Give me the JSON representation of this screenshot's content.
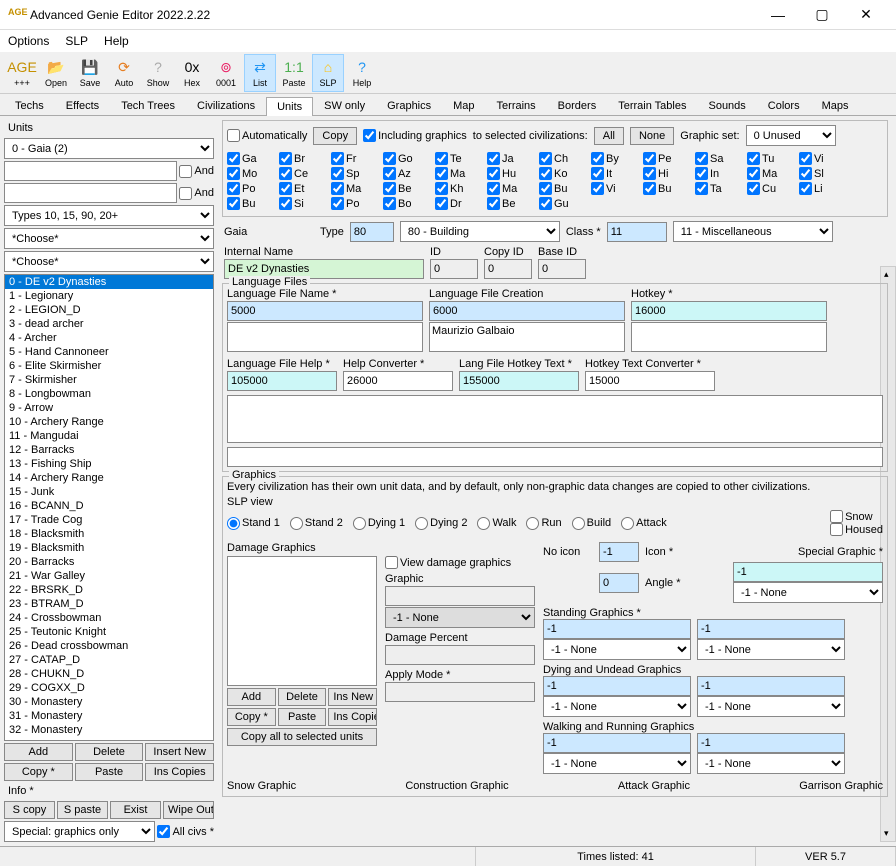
{
  "window": {
    "title": "Advanced Genie Editor 2022.2.22",
    "icon_label": "AGE"
  },
  "menu": [
    "Options",
    "SLP",
    "Help"
  ],
  "toolbar": [
    {
      "label": "+++",
      "name": "age-icon",
      "glyph": "AGE",
      "active": false,
      "color": "#c49000"
    },
    {
      "label": "Open",
      "name": "open-button",
      "glyph": "📂",
      "active": false
    },
    {
      "label": "Save",
      "name": "save-button",
      "glyph": "💾",
      "active": false
    },
    {
      "label": "Auto",
      "name": "auto-button",
      "glyph": "⟳",
      "active": false,
      "color": "#e67e22"
    },
    {
      "label": "Show",
      "name": "show-button",
      "glyph": "?",
      "active": false,
      "color": "#aaa"
    },
    {
      "label": "Hex",
      "name": "hex-button",
      "glyph": "0x",
      "active": false
    },
    {
      "label": "0001",
      "name": "0001-button",
      "glyph": "⊚",
      "active": false,
      "color": "#e91e63"
    },
    {
      "label": "List",
      "name": "list-button",
      "glyph": "⇄",
      "active": true,
      "color": "#2196f3"
    },
    {
      "label": "Paste",
      "name": "paste-button",
      "glyph": "1:1",
      "active": false,
      "color": "#4caf50"
    },
    {
      "label": "SLP",
      "name": "slp-button",
      "glyph": "⌂",
      "active": true,
      "color": "#ffc107"
    },
    {
      "label": "Help",
      "name": "help-button",
      "glyph": "?",
      "active": false,
      "color": "#2196f3"
    }
  ],
  "tabs": [
    "Techs",
    "Effects",
    "Tech Trees",
    "Civilizations",
    "Units",
    "SW only",
    "Graphics",
    "Map",
    "Terrains",
    "Borders",
    "Terrain Tables",
    "Sounds",
    "Colors",
    "Maps"
  ],
  "active_tab": "Units",
  "left": {
    "units_label": "Units",
    "civ_select": "0 - Gaia (2)",
    "and_label": "And",
    "types_filter": "Types 10, 15, 90, 20+",
    "choose": "*Choose*",
    "units": [
      "0 - DE v2 Dynasties",
      "1 - Legionary",
      "2 - LEGION_D",
      "3 - dead archer",
      "4 - Archer",
      "5 - Hand Cannoneer",
      "6 - Elite Skirmisher",
      "7 - Skirmisher",
      "8 - Longbowman",
      "9 - Arrow",
      "10 - Archery Range",
      "11 - Mangudai",
      "12 - Barracks",
      "13 - Fishing Ship",
      "14 - Archery Range",
      "15 - Junk",
      "16 - BCANN_D",
      "17 - Trade Cog",
      "18 - Blacksmith",
      "19 - Blacksmith",
      "20 - Barracks",
      "21 - War Galley",
      "22 - BRSRK_D",
      "23 - BTRAM_D",
      "24 - Crossbowman",
      "25 - Teutonic Knight",
      "26 - Dead crossbowman",
      "27 - CATAP_D",
      "28 - CHUKN_D",
      "29 - COGXX_D",
      "30 - Monastery",
      "31 - Monastery",
      "32 - Monastery"
    ],
    "selected_unit": 0,
    "buttons": {
      "add": "Add",
      "delete": "Delete",
      "insert_new": "Insert New",
      "copy": "Copy *",
      "paste": "Paste",
      "ins_copies": "Ins Copies",
      "info": "Info *",
      "s_copy": "S copy",
      "s_paste": "S paste",
      "exist": "Exist",
      "wipe_out": "Wipe Out",
      "special": "Special: graphics only",
      "all_civs": "All civs *"
    }
  },
  "right": {
    "auto_label": "Automatically",
    "copy_btn": "Copy",
    "including_label": "Including graphics",
    "to_selected_label": "to selected civilizations:",
    "all_btn": "All",
    "none_btn": "None",
    "graphic_set_label": "Graphic set:",
    "graphic_set_value": "0 Unused",
    "civs": [
      "Ga",
      "Br",
      "Fr",
      "Go",
      "Te",
      "Ja",
      "Ch",
      "By",
      "Pe",
      "Sa",
      "Tu",
      "Vi",
      "Mo",
      "Ce",
      "Sp",
      "Az",
      "Ma",
      "Hu",
      "Ko",
      "It",
      "Hi",
      "In",
      "Ma",
      "Sl",
      "Po",
      "Et",
      "Ma",
      "Be",
      "Kh",
      "Ma",
      "Bu",
      "Vi",
      "Bu",
      "Ta",
      "Cu",
      "Li",
      "Bu",
      "Si",
      "Po",
      "Bo",
      "Dr",
      "Be",
      "Gu"
    ],
    "unit_header": {
      "civ_name": "Gaia",
      "type_label": "Type",
      "type_value": "80",
      "type_combo": "80 - Building",
      "class_label": "Class *",
      "class_value": "11",
      "class_combo": "11 - Miscellaneous",
      "internal_name_label": "Internal Name",
      "internal_name": "DE v2 Dynasties",
      "id_label": "ID",
      "id_value": "0",
      "copy_id_label": "Copy ID",
      "copy_id_value": "0",
      "base_id_label": "Base ID",
      "base_id_value": "0"
    },
    "lang": {
      "group": "Language Files",
      "name_label": "Language File Name *",
      "name_value": "5000",
      "creation_label": "Language File Creation",
      "creation_value": "6000",
      "creation_text": "Maurizio Galbaio",
      "hotkey_label": "Hotkey *",
      "hotkey_value": "16000",
      "help_label": "Language File Help *",
      "help_value": "105000",
      "help_conv_label": "Help Converter *",
      "help_conv_value": "26000",
      "hotkey_text_label": "Lang File Hotkey Text *",
      "hotkey_text_value": "155000",
      "hotkey_conv_label": "Hotkey Text Converter *",
      "hotkey_conv_value": "15000"
    },
    "graphics": {
      "group": "Graphics",
      "desc": "Every civilization has their own unit data, and by default, only non-graphic data changes are copied to other civilizations.",
      "slp_view": "SLP view",
      "views": [
        "Stand 1",
        "Stand 2",
        "Dying 1",
        "Dying 2",
        "Walk",
        "Run",
        "Build",
        "Attack"
      ],
      "snow": "Snow",
      "housed": "Housed",
      "damage_label": "Damage Graphics",
      "view_damage": "View damage graphics",
      "graphic_label": "Graphic",
      "none": "-1 - None",
      "damage_pct": "Damage Percent",
      "apply_mode": "Apply Mode *",
      "dg_buttons": {
        "add": "Add",
        "delete": "Delete",
        "ins_new": "Ins New",
        "copy": "Copy *",
        "paste": "Paste",
        "ins_copies": "Ins Copies",
        "copy_all": "Copy all to selected units"
      },
      "no_icon": "No icon",
      "icon_label": "Icon *",
      "icon_val": "-1",
      "angle_label": "Angle *",
      "angle_val": "0",
      "special_graphic": "Special Graphic *",
      "special_val": "-1",
      "standing": "Standing Graphics *",
      "dying": "Dying and Undead Graphics",
      "walking": "Walking and Running Graphics",
      "neg1": "-1",
      "bottom": {
        "snow": "Snow Graphic",
        "construction": "Construction Graphic",
        "attack": "Attack Graphic",
        "garrison": "Garrison Graphic"
      }
    }
  },
  "status": {
    "times": "Times listed: 41",
    "ver": "VER 5.7"
  }
}
